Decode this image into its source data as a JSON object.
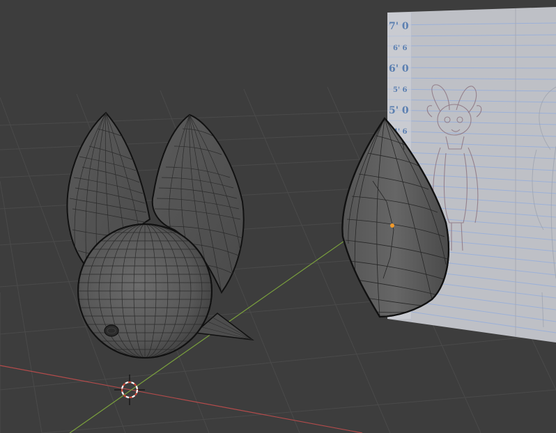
{
  "viewport": {
    "background": "#3d3d3d",
    "grid_color": "#4a4a4a",
    "x_axis_color": "#b34b4b",
    "y_axis_color": "#7aa03d",
    "wire_color": "#1a1a1a",
    "selection_outline": "#e08a1a",
    "origin_color": "#f29a2a"
  },
  "reference_sheet": {
    "height_labels": [
      "7' 0",
      "6' 6",
      "6' 0",
      "5' 6",
      "5' 0",
      "4' 6"
    ],
    "line_color": "#9bb0d8",
    "paper_color": "#c9cbd1"
  },
  "objects": [
    {
      "name": "Head sphere with ears",
      "selected": false
    },
    {
      "name": "Ear",
      "selected": true
    }
  ],
  "cursor": {
    "icon": "3d-cursor-icon"
  }
}
